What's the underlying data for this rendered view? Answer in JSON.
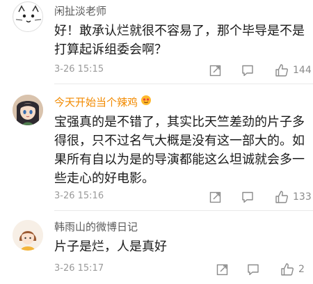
{
  "comments": [
    {
      "user": "闲扯淡老师",
      "text": "好！敢承认烂就很不容易了，那个毕导是不是打算起诉组委会啊？",
      "time": "3-26 15:15",
      "likes": "144"
    },
    {
      "user": "今天开始当个辣鸡",
      "text": "宝强真的是不错了，其实比天竺差劲的片子多得很，只不过名气大概是没有这一部大的。如果所有自以为是的导演都能这么坦诚就会多一些走心的好电影。",
      "time": "3-26 15:16",
      "likes": "133"
    },
    {
      "user": "韩雨山的微博日记",
      "text": "片子是烂，人是真好",
      "time": "3-26 15:17",
      "likes": "2"
    }
  ],
  "colors": {
    "vip_name": "#f28a00",
    "name": "#5a5a5a",
    "meta": "#9a9a9a"
  }
}
